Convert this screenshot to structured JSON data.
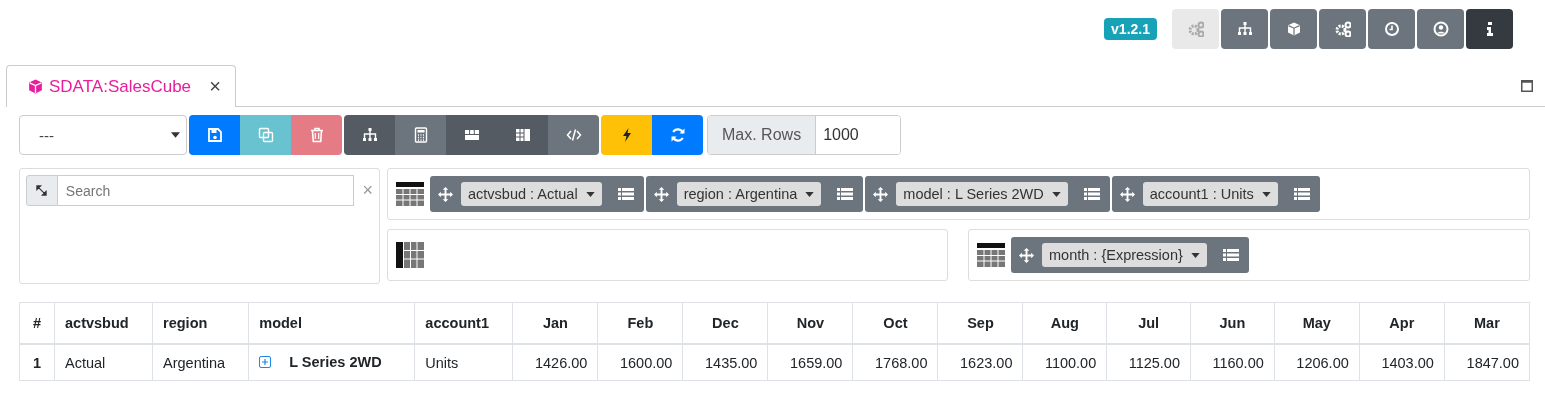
{
  "version": "v1.2.1",
  "top_buttons": [
    {
      "disabled": true,
      "active": false
    },
    {
      "disabled": false,
      "active": false
    },
    {
      "disabled": false,
      "active": false
    },
    {
      "disabled": false,
      "active": false
    },
    {
      "disabled": false,
      "active": false
    },
    {
      "disabled": false,
      "active": false
    },
    {
      "disabled": false,
      "active": true
    }
  ],
  "tabs": [
    {
      "label": "SDATA:SalesCube",
      "close": "×",
      "selected": true
    }
  ],
  "toolbar": {
    "view_select": "---",
    "groups": [
      [
        {
          "kind": "primary"
        },
        {
          "kind": "info"
        },
        {
          "kind": "danger"
        }
      ],
      [
        {
          "kind": "dark"
        },
        {
          "kind": "secondary"
        },
        {
          "kind": "dark"
        },
        {
          "kind": "dark"
        },
        {
          "kind": "secondary"
        }
      ],
      [
        {
          "kind": "warning"
        },
        {
          "kind": "primary"
        }
      ]
    ],
    "max_rows_label": "Max. Rows",
    "max_rows": "1000"
  },
  "search": {
    "placeholder": "Search",
    "clear": "×"
  },
  "filter_zone": [
    {
      "label": "actvsbud : Actual"
    },
    {
      "label": "region : Argentina"
    },
    {
      "label": "model : L Series 2WD"
    },
    {
      "label": "account1 : Units"
    }
  ],
  "column_zone": [
    {
      "label": "month : {Expression}"
    }
  ],
  "table": {
    "columns": [
      {
        "label": "#",
        "kind": "index"
      },
      {
        "label": "actvsbud",
        "kind": "text"
      },
      {
        "label": "region",
        "kind": "text"
      },
      {
        "label": "model",
        "kind": "text"
      },
      {
        "label": "account1",
        "kind": "text"
      },
      {
        "label": "Jan",
        "kind": "number"
      },
      {
        "label": "Feb",
        "kind": "number"
      },
      {
        "label": "Dec",
        "kind": "number"
      },
      {
        "label": "Nov",
        "kind": "number"
      },
      {
        "label": "Oct",
        "kind": "number"
      },
      {
        "label": "Sep",
        "kind": "number"
      },
      {
        "label": "Aug",
        "kind": "number"
      },
      {
        "label": "Jul",
        "kind": "number"
      },
      {
        "label": "Jun",
        "kind": "number"
      },
      {
        "label": "May",
        "kind": "number"
      },
      {
        "label": "Apr",
        "kind": "number"
      },
      {
        "label": "Mar",
        "kind": "number"
      }
    ],
    "rows": [
      {
        "cells": [
          {
            "text": "1",
            "kind": "index"
          },
          {
            "text": "Actual",
            "kind": "text"
          },
          {
            "text": "Argentina",
            "kind": "text"
          },
          {
            "text": "L Series 2WD",
            "kind": "member",
            "expandable": true
          },
          {
            "text": "Units",
            "kind": "text"
          },
          {
            "text": "1426.00",
            "kind": "number"
          },
          {
            "text": "1600.00",
            "kind": "number"
          },
          {
            "text": "1435.00",
            "kind": "number"
          },
          {
            "text": "1659.00",
            "kind": "number"
          },
          {
            "text": "1768.00",
            "kind": "number"
          },
          {
            "text": "1623.00",
            "kind": "number"
          },
          {
            "text": "1100.00",
            "kind": "number"
          },
          {
            "text": "1125.00",
            "kind": "number"
          },
          {
            "text": "1160.00",
            "kind": "number"
          },
          {
            "text": "1206.00",
            "kind": "number"
          },
          {
            "text": "1403.00",
            "kind": "number"
          },
          {
            "text": "1847.00",
            "kind": "number"
          }
        ]
      }
    ]
  }
}
